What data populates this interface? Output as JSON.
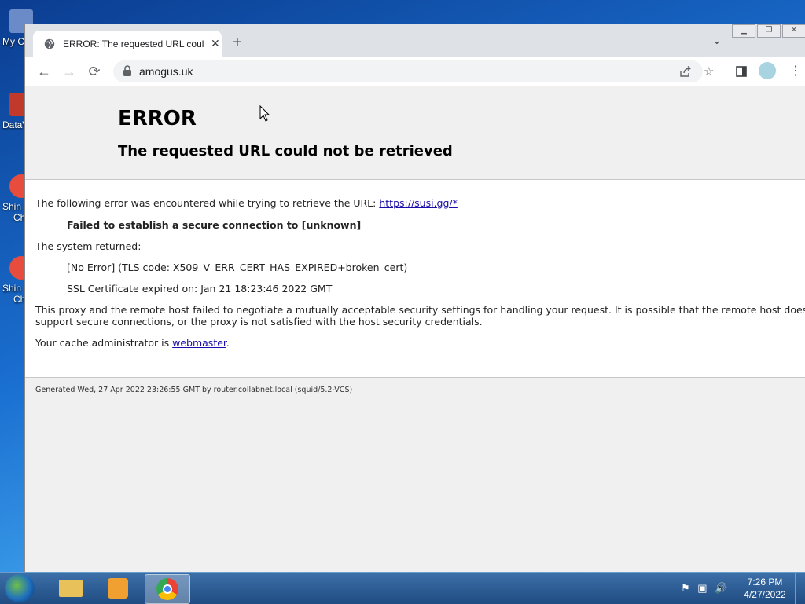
{
  "desktop": {
    "icons": [
      {
        "label": "My C",
        "color": "#6a8bc7"
      },
      {
        "label": "DataV",
        "color": "#c0392b"
      },
      {
        "label": "Shin",
        "sublabel": "Ch",
        "color": "#e74c3c"
      },
      {
        "label": "Shin",
        "sublabel": "Ch",
        "color": "#e74c3c"
      }
    ]
  },
  "browser": {
    "tab": {
      "title": "ERROR: The requested URL could",
      "favicon": "globe-icon",
      "close": "✕"
    },
    "new_tab": "+",
    "tab_search": "⌄",
    "window_buttons": [
      "minimize",
      "restore",
      "close"
    ],
    "toolbar": {
      "back": "←",
      "forward": "→",
      "reload": "⟳",
      "url": "amogus.uk",
      "share_icon": "share-icon",
      "bookmark": "☆",
      "side_panel": "side-panel-icon",
      "menu": "⋮"
    }
  },
  "page": {
    "title": "ERROR",
    "subtitle": "The requested URL could not be retrieved",
    "intro": "The following error was encountered while trying to retrieve the URL: ",
    "link_url": "https://susi.gg/*",
    "failure": "Failed to establish a secure connection to [unknown]",
    "system_returned": "The system returned:",
    "tls": "[No Error] (TLS code: X509_V_ERR_CERT_HAS_EXPIRED+broken_cert)",
    "ssl_expired": "SSL Certificate expired on: Jan 21 18:23:46 2022 GMT",
    "proxy_line1": "This proxy and the remote host failed to negotiate a mutually acceptable security settings for handling your request. It is possible that the remote host does not",
    "proxy_line2": "support secure connections, or the proxy is not satisfied with the host security credentials.",
    "cache_prefix": "Your cache administrator is ",
    "cache_link": "webmaster",
    "cache_suffix": ".",
    "footer": "Generated Wed, 27 Apr 2022 23:26:55 GMT by router.collabnet.local (squid/5.2-VCS)"
  },
  "taskbar": {
    "items": [
      "start-button",
      "explorer",
      "media-player",
      "chrome"
    ],
    "clock_time": "7:26 PM",
    "clock_date": "4/27/2022"
  }
}
